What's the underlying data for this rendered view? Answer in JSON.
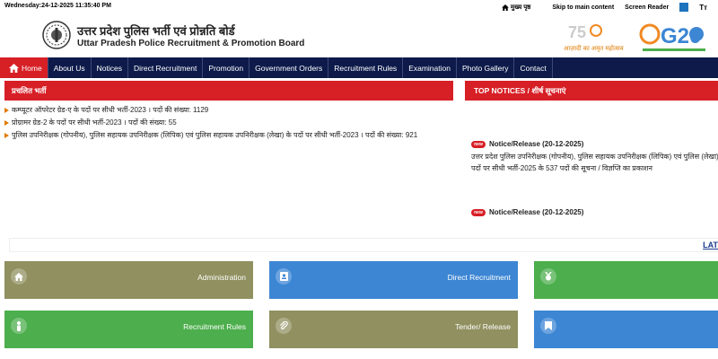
{
  "topbar": {
    "date": "Wednesday:24-12-2025 11:35:40 PM",
    "home_link": "मुख्य पृष्ठ",
    "skip": "Skip to main content",
    "screen_reader": "Screen Reader",
    "tt": "Tт"
  },
  "header": {
    "title_hindi": "उत्तर प्रदेश पुलिस भर्ती एवं प्रोन्नति बोर्ड",
    "title_english": "Uttar Pradesh Police Recruitment & Promotion Board",
    "azadi_text": "आज़ादी का अमृत महोत्सव",
    "g20_text": "G20"
  },
  "nav": {
    "items": [
      "Home",
      "About Us",
      "Notices",
      "Direct Recruitment",
      "Promotion",
      "Government Orders",
      "Recruitment Rules",
      "Examination",
      "Photo Gallery",
      "Contact"
    ]
  },
  "left_panel": {
    "title": "प्रचलित भर्ती",
    "items": [
      "कम्प्यूटर ऑपरेटर ग्रेड-ए के पदों पर सीधी भर्ती-2023 । पदों की संख्या: 1129",
      "प्रोग्रामर ग्रेड-2 के पदों पर सीधी भर्ती-2023 । पदों की संख्या: 55",
      "पुलिस उपनिरीक्षक (गोपनीय), पुलिस सहायक उपनिरीक्षक (लिपिक) एवं पुलिस सहायक उपनिरीक्षक (लेखा) के पदों पर सीधी भर्ती-2023 । पदों की संख्या: 921"
    ]
  },
  "right_panel": {
    "title": "TOP NOTICES / शीर्ष सूचनाएं",
    "new_badge": "new",
    "notices": [
      {
        "title": "Notice/Release (20-12-2025)",
        "body": "उत्तर प्रदेश पुलिस उपनिरीक्षक (गोपनीय), पुलिस सहायक उपनिरीक्षक (लिपिक) एवं पुलिस (लेखा) के पदों पर सीधी भर्ती-2025 के 537 पदों की सूचना / विज्ञप्ति का प्रकाशन"
      },
      {
        "title": "Notice/Release (20-12-2025)"
      }
    ]
  },
  "ticker": {
    "text": "LAT"
  },
  "tiles": [
    {
      "label": "Administration",
      "color": "#909060"
    },
    {
      "label": "Direct Recruitment",
      "color": "#3c86d4"
    },
    {
      "label": "",
      "color": "#4cae4c"
    },
    {
      "label": "Recruitment Rules",
      "color": "#4cae4c"
    },
    {
      "label": "Tender/ Release",
      "color": "#909060"
    },
    {
      "label": "",
      "color": "#3c86d4"
    }
  ]
}
